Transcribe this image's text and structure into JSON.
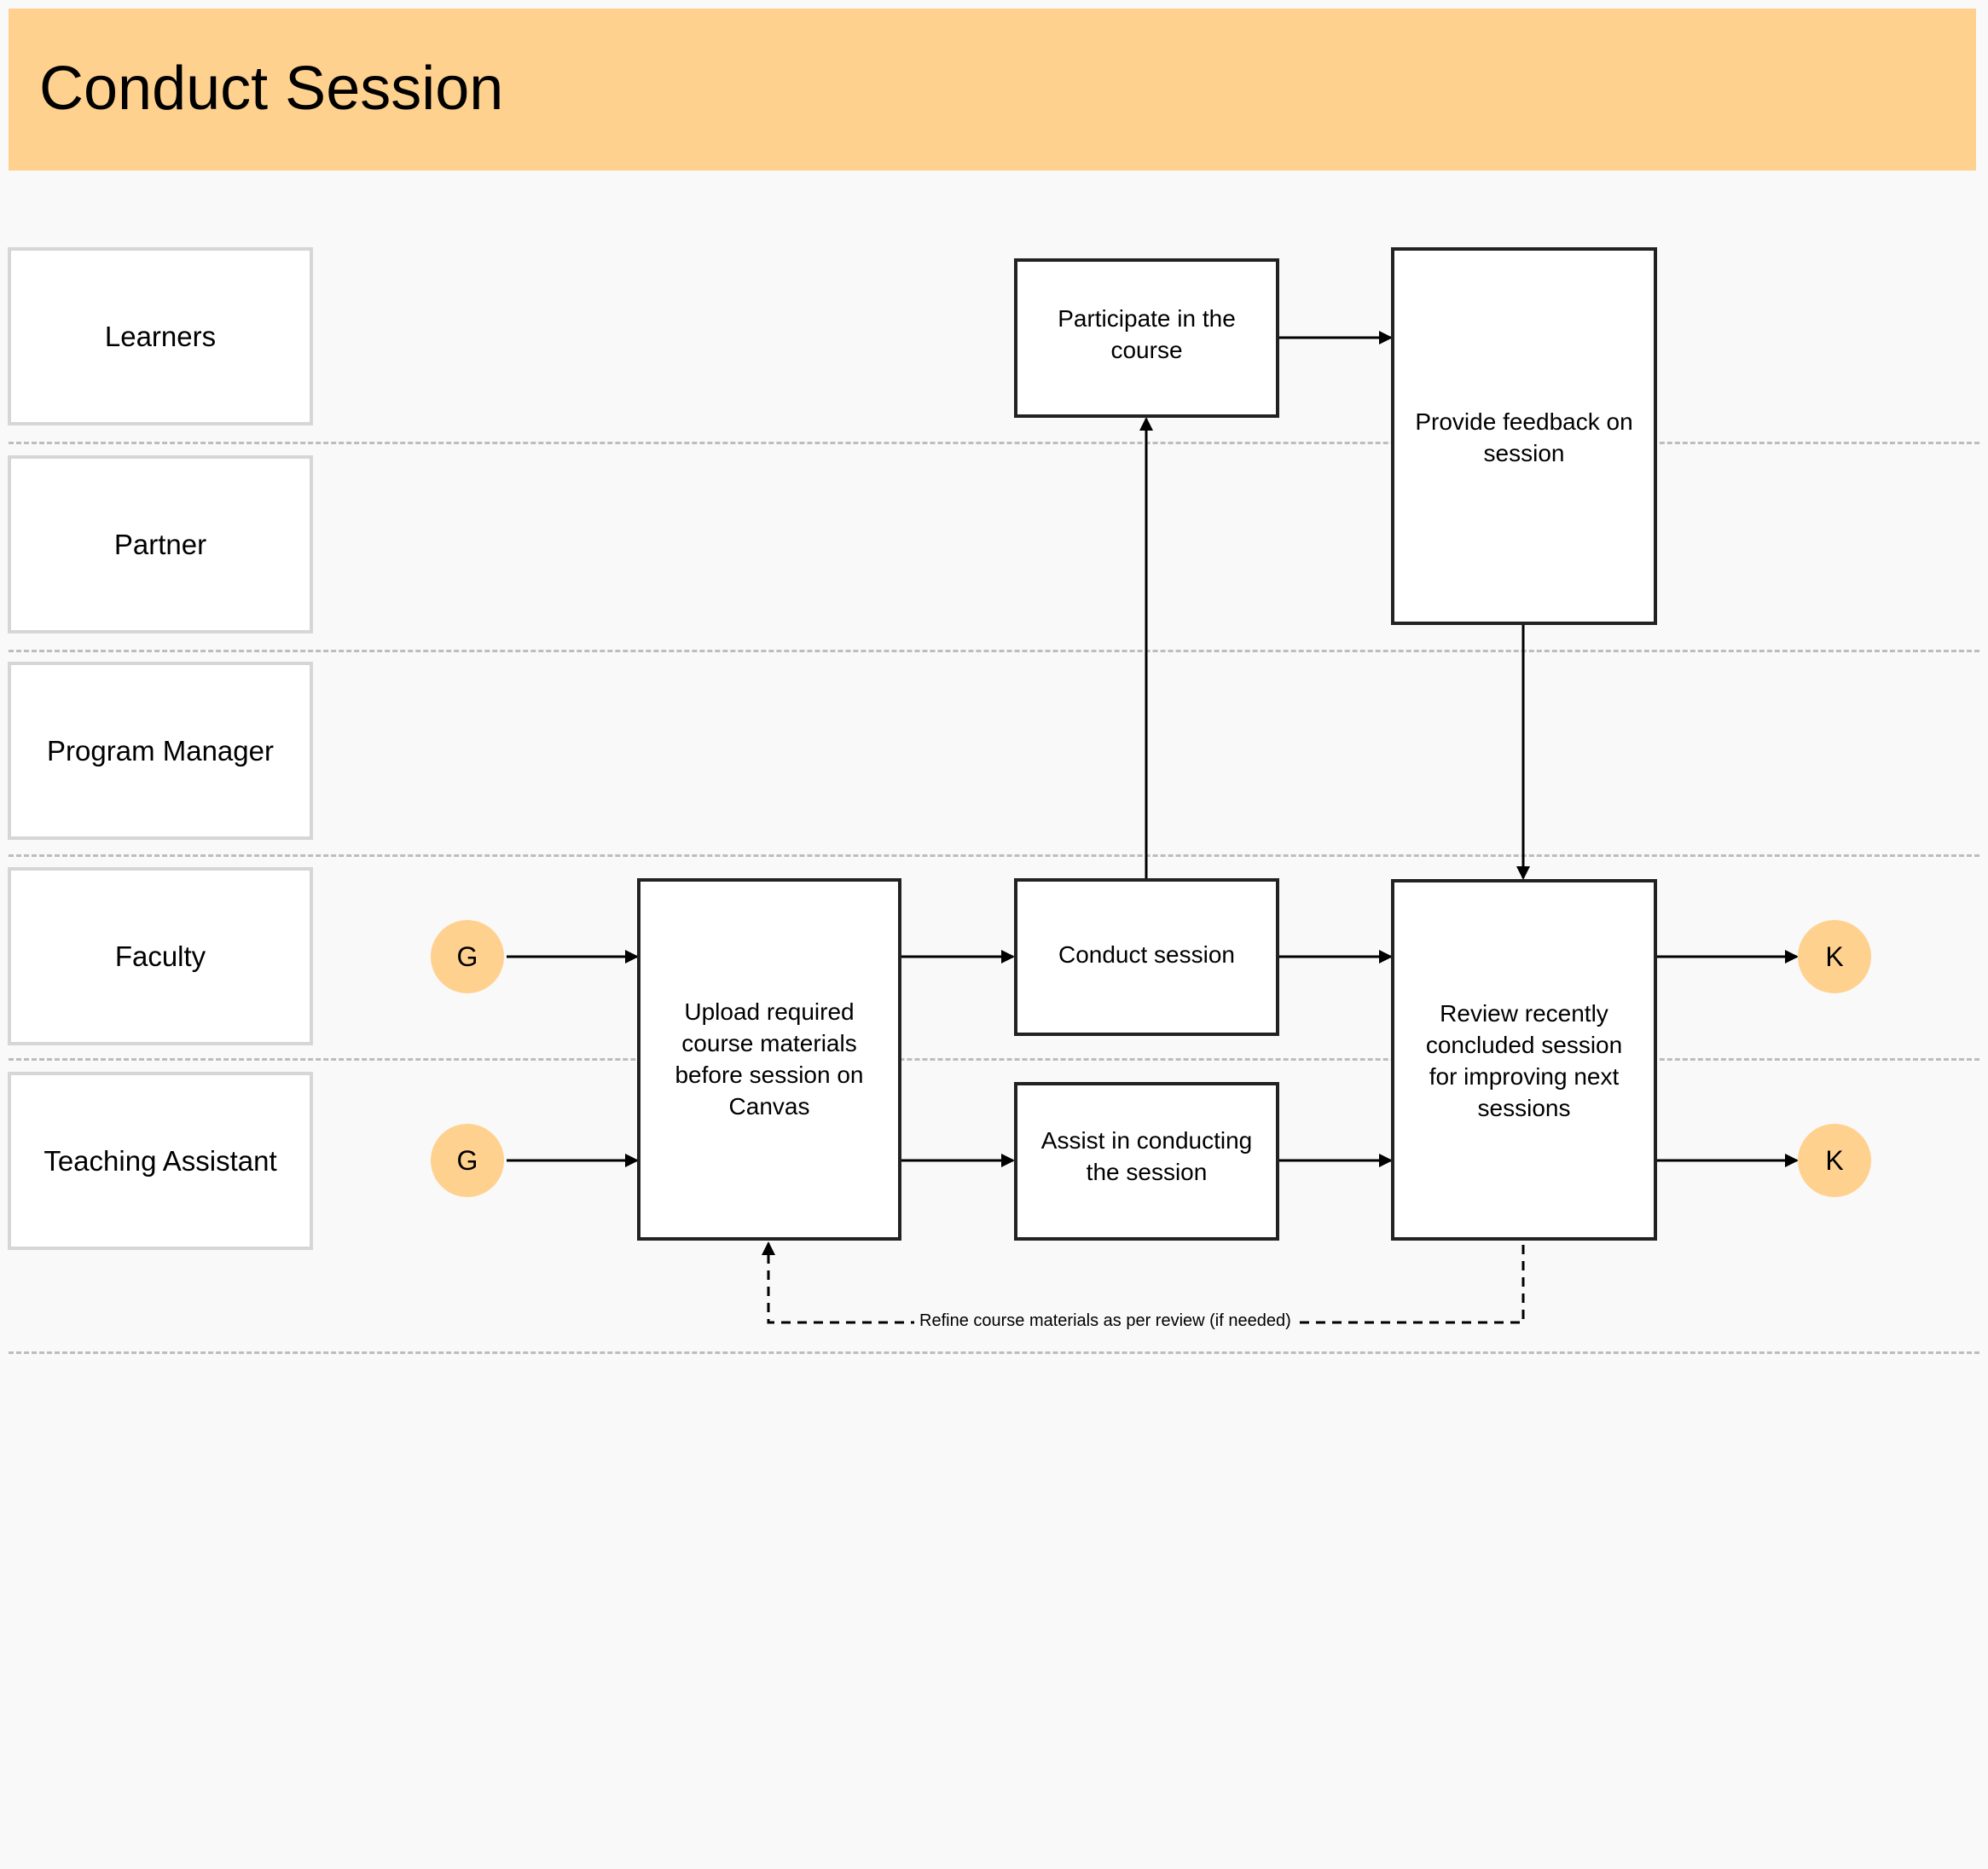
{
  "header": {
    "title": "Conduct Session",
    "color": "#ffd18f"
  },
  "lanes": [
    {
      "label": "Learners"
    },
    {
      "label": "Partner"
    },
    {
      "label": "Program Manager"
    },
    {
      "label": "Faculty"
    },
    {
      "label": "Teaching Assistant"
    }
  ],
  "nodes": {
    "participate": "Participate in the course",
    "feedback": "Provide feedback on session",
    "upload": "Upload required course materials before session on Canvas",
    "conduct": "Conduct session",
    "assist": "Assist in conducting the session",
    "review": "Review recently concluded session for improving next sessions"
  },
  "connectors": {
    "start_faculty": "G",
    "start_ta": "G",
    "end_faculty": "K",
    "end_ta": "K",
    "loop_label": "Refine course materials as per review (if needed)"
  }
}
